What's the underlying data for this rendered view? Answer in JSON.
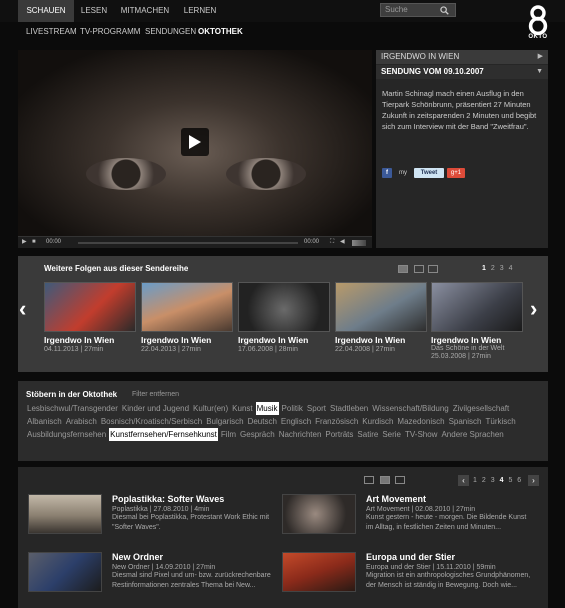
{
  "nav": {
    "main": [
      "SCHAUEN",
      "LESEN",
      "MITMACHEN",
      "LERNEN"
    ],
    "sub": [
      "LIVESTREAM",
      "TV-PROGRAMM",
      "SENDUNGEN",
      "OKTOTHEK"
    ],
    "search_placeholder": "Suche",
    "search_icon": "magnifier-icon",
    "logo_text": "OKTO"
  },
  "player": {
    "time_elapsed": "00:00",
    "time_total": "00:00",
    "play_icon": "play-icon"
  },
  "info": {
    "show": "IRGENDWO IN WIEN",
    "episode": "SENDUNG VOM 09.10.2007",
    "description": "Martin Schinagl mach einen Ausflug in den Tierpark Schönbrunn, präsentiert 27 Minuten Zukunft in zeitsparenden 2 Minuten und begibt sich zum Interview mit der Band \"Zweitfrau\".",
    "share": {
      "facebook": "f",
      "myspace": "my",
      "tweet": "Tweet",
      "gplus": "g+1"
    }
  },
  "folgen": {
    "title": "Weitere Folgen aus dieser Sendereihe",
    "pages": [
      "1",
      "2",
      "3",
      "4"
    ],
    "current_page": "1",
    "episodes": [
      {
        "title": "Irgendwo In Wien",
        "subtitle": "",
        "date": "04.11.2013",
        "dur": "27min"
      },
      {
        "title": "Irgendwo In Wien",
        "subtitle": "",
        "date": "22.04.2013",
        "dur": "27min"
      },
      {
        "title": "Irgendwo In Wien",
        "subtitle": "",
        "date": "17.06.2008",
        "dur": "28min"
      },
      {
        "title": "Irgendwo In Wien",
        "subtitle": "",
        "date": "22.04.2008",
        "dur": "27min"
      },
      {
        "title": "Irgendwo In Wien",
        "subtitle": "Das Schöne in der Welt",
        "date": "25.03.2008",
        "dur": "27min"
      }
    ]
  },
  "stoebern": {
    "title": "Stöbern in der Oktothek",
    "filter_remove": "Filter entfernen",
    "tags": [
      "Lesbischwul/Transgender",
      "Kinder und Jugend",
      "Kultur(en)",
      "Kunst",
      "Musik",
      "Politik",
      "Sport",
      "Stadtleben",
      "Wissenschaft/Bildung",
      "Zivilgesellschaft",
      "Albanisch",
      "Arabisch",
      "Bosnisch/Kroatisch/Serbisch",
      "Bulgarisch",
      "Deutsch",
      "Englisch",
      "Französisch",
      "Kurdisch",
      "Mazedonisch",
      "Spanisch",
      "Türkisch",
      "Ausbildungsfernsehen",
      "Kunstfernsehen/Fernsehkunst",
      "Film",
      "Gespräch",
      "Nachrichten",
      "Porträts",
      "Satire",
      "Serie",
      "TV-Show",
      "Andere Sprachen"
    ],
    "active_tags": [
      "Musik",
      "Kunstfernsehen/Fernsehkunst"
    ]
  },
  "list": {
    "pages": [
      "1",
      "2",
      "3",
      "4",
      "5",
      "6"
    ],
    "current_page": "4",
    "items": [
      {
        "title": "Poplastikka: Softer Waves",
        "meta": "Poplastikka | 27.08.2010 | 4min",
        "desc": "Diesmal bei Poplastikka, Protestant Work Ethic mit \"Softer Waves\"."
      },
      {
        "title": "Art Movement",
        "meta": "Art Movement | 02.08.2010 | 27min",
        "desc": "Kunst gestern - heute - morgen. Die Bildende Kunst im Alltag, in festlichen Zeiten und Minuten..."
      },
      {
        "title": "New Ordner",
        "meta": "New Ordner | 14.09.2010 | 27min",
        "desc": "Diesmal sind Pixel und um- bzw. zurückrechenbare Restinformationen zentrales Thema bei New..."
      },
      {
        "title": "Europa und der Stier",
        "meta": "Europa und der Stier | 15.11.2010 | 59min",
        "desc": "Migration ist ein anthropologisches Grundphänomen, der Mensch ist ständig in Bewegung. Doch wie..."
      }
    ]
  }
}
